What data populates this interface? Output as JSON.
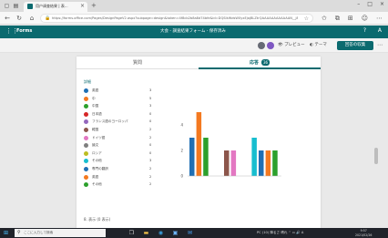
{
  "browser": {
    "tab_title": "用户调查结果 | 表...",
    "url": "https://forms.office.com/Pages/DesignPageV2.aspx?subpage=design&token=4f8cb2b8a8d74bfe&id=DQSIkWdsW0yxEjajBLZtrQAAAAAAAAAAAAN__j8RcE5UNEc&analysis=true"
  },
  "app": {
    "name": "Forms",
    "doc_title": "大会 - 調査結果フォーム - 保存済み"
  },
  "command_bar": {
    "preview_label": "プレビュー",
    "theme_label": "テーマ",
    "collect_label": "回答の収集",
    "avatar_colors": [
      "#666a74",
      "#7e57c2"
    ]
  },
  "tabs": {
    "questions": "質問",
    "responses": "応答",
    "response_count": "36"
  },
  "legend_header": "詳細",
  "legend": [
    {
      "label": "英語",
      "value": "3",
      "color": "#1f6fb4"
    },
    {
      "label": "中",
      "value": "5",
      "color": "#f47920"
    },
    {
      "label": "中国",
      "value": "3",
      "color": "#2ca02c"
    },
    {
      "label": "日本語",
      "value": "0",
      "color": "#d62728"
    },
    {
      "label": "フランス語のヨーロッパ",
      "value": "0",
      "color": "#9467bd"
    },
    {
      "label": "韓国",
      "value": "2",
      "color": "#8c564b"
    },
    {
      "label": "ドイツ語",
      "value": "2",
      "color": "#e377c2"
    },
    {
      "label": "論文",
      "value": "0",
      "color": "#7f7f7f"
    },
    {
      "label": "ロシア",
      "value": "0",
      "color": "#bcbd22"
    },
    {
      "label": "その他",
      "value": "3",
      "color": "#17becf"
    },
    {
      "label": "専門の翻訳",
      "value": "2",
      "color": "#1f6fb4"
    },
    {
      "label": "英語",
      "value": "2",
      "color": "#f47920"
    },
    {
      "label": "その他",
      "value": "2",
      "color": "#2ca02c"
    }
  ],
  "chart_data": {
    "type": "bar",
    "categories": [
      "英語",
      "中",
      "中国",
      "日本語",
      "フランス語のヨーロッパ",
      "韓国",
      "ドイツ語",
      "論文",
      "ロシア",
      "その他",
      "専門の翻訳",
      "英語",
      "その他"
    ],
    "values": [
      3,
      5,
      3,
      0,
      0,
      2,
      2,
      0,
      0,
      3,
      2,
      2,
      2
    ],
    "colors": [
      "#1f6fb4",
      "#f47920",
      "#2ca02c",
      "#d62728",
      "#9467bd",
      "#8c564b",
      "#e377c2",
      "#7f7f7f",
      "#bcbd22",
      "#17becf",
      "#1f6fb4",
      "#f47920",
      "#2ca02c"
    ],
    "yticks": [
      "4",
      "2",
      "0"
    ],
    "ylim": [
      0,
      5
    ],
    "grid": false,
    "legend_position": "left"
  },
  "footer": "8. 表示 (0 表示)",
  "taskbar": {
    "search_placeholder": "ここに入力して検索",
    "tray_text": "PC (10) 降るさ 晴れ",
    "tray_lang": "A",
    "time": "9:57",
    "date": "2021/02/26"
  }
}
